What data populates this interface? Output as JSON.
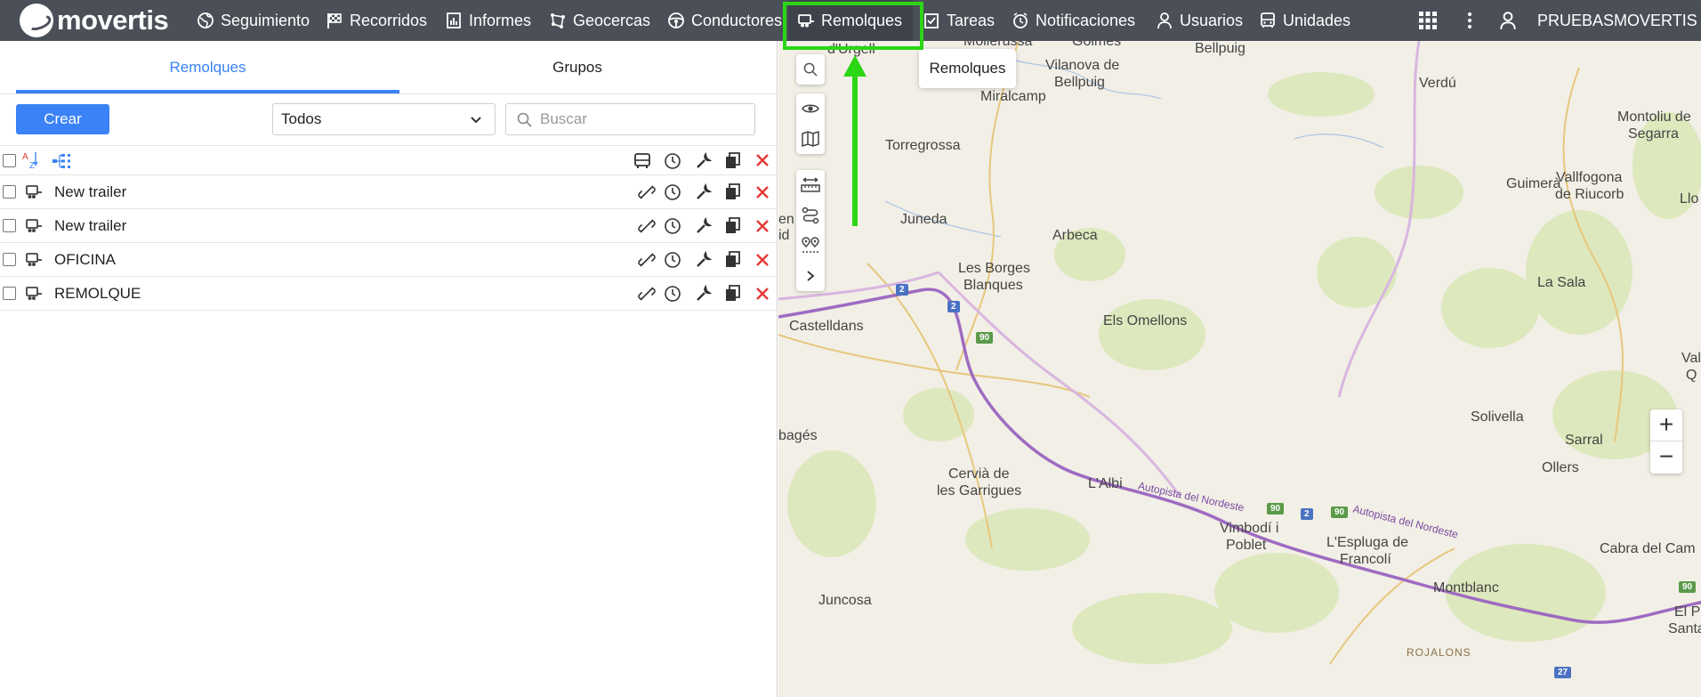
{
  "app": {
    "brand": "movertis",
    "nav": [
      {
        "id": "seguimiento",
        "label": "Seguimiento",
        "icon": "globe-icon"
      },
      {
        "id": "recorridos",
        "label": "Recorridos",
        "icon": "checkered-flag-icon"
      },
      {
        "id": "informes",
        "label": "Informes",
        "icon": "report-chart-icon"
      },
      {
        "id": "geocercas",
        "label": "Geocercas",
        "icon": "geofence-icon"
      },
      {
        "id": "conductores",
        "label": "Conductores",
        "icon": "steering-wheel-icon"
      },
      {
        "id": "remolques",
        "label": "Remolques",
        "icon": "trailer-icon",
        "active": true
      },
      {
        "id": "tareas",
        "label": "Tareas",
        "icon": "task-check-icon"
      },
      {
        "id": "notificaciones",
        "label": "Notificaciones",
        "icon": "alarm-clock-icon"
      },
      {
        "id": "usuarios",
        "label": "Usuarios",
        "icon": "user-icon"
      },
      {
        "id": "unidades",
        "label": "Unidades",
        "icon": "bus-icon"
      }
    ],
    "username": "PRUEBASMOVERTIS",
    "colors": {
      "topbar": "#4b4f58",
      "accent": "#3b82f6",
      "delete": "#e53935",
      "highlight": "#2bd615"
    }
  },
  "panel": {
    "tabs": [
      {
        "label": "Remolques",
        "active": true
      },
      {
        "label": "Grupos",
        "active": false
      }
    ],
    "create_label": "Crear",
    "filter_value": "Todos",
    "search_placeholder": "Buscar",
    "rows": [
      {
        "name": "New trailer"
      },
      {
        "name": "New trailer"
      },
      {
        "name": "OFICINA"
      },
      {
        "name": "REMOLQUE"
      }
    ]
  },
  "map": {
    "tooltip": "Remolques",
    "labels": {
      "durgell": "d'Urgell",
      "mollerussa": "Mollerussa",
      "golmes": "Golmés",
      "bellpuig": "Bellpuig",
      "vilanova1": "Vilanova de",
      "vilanova2": "Bellpuig",
      "miralcamp": "Miralcamp",
      "verdu": "Verdú",
      "montoliu1": "Montoliu de",
      "montoliu2": "Segarra",
      "torregrossa": "Torregrossa",
      "guimera": "Guimerà",
      "vallfogona1": "Vallfogona",
      "vallfogona2": "de Riucorb",
      "llo": "Llo",
      "juneda": "Juneda",
      "arbeca": "Arbeca",
      "borges1": "Les Borges",
      "borges2": "Blanques",
      "en": "en",
      "id": "id",
      "lasala": "La Sala",
      "castelldans": "Castelldans",
      "omellons": "Els Omellons",
      "val": "Val",
      "q": "Q",
      "solivella": "Solivella",
      "sarral": "Sarral",
      "bages": "bagés",
      "ollers": "Ollers",
      "cervia1": "Cervià de",
      "cervia2": "les Garrigues",
      "albi": "L'Albi",
      "autopista1": "Autopista del Nordeste",
      "autopista2": "Autopista del Nordeste",
      "vimbodi1": "Vimbodí i",
      "vimbodi2": "Poblet",
      "espluga1": "L'Espluga de",
      "espluga2": "Francolí",
      "cabra": "Cabra del Cam",
      "montblanc": "Montblanc",
      "juncosa": "Juncosa",
      "elpla1": "El Pla d",
      "elpla2": "Santa Ma",
      "rojalons": "ROJALONS"
    },
    "shields": {
      "s2a": "2",
      "s2b": "2",
      "s90a": "90",
      "s90b": "90",
      "s2c": "2",
      "s90c": "90",
      "s90d": "90",
      "s27": "27"
    },
    "zoom_in": "+",
    "zoom_out": "−"
  }
}
